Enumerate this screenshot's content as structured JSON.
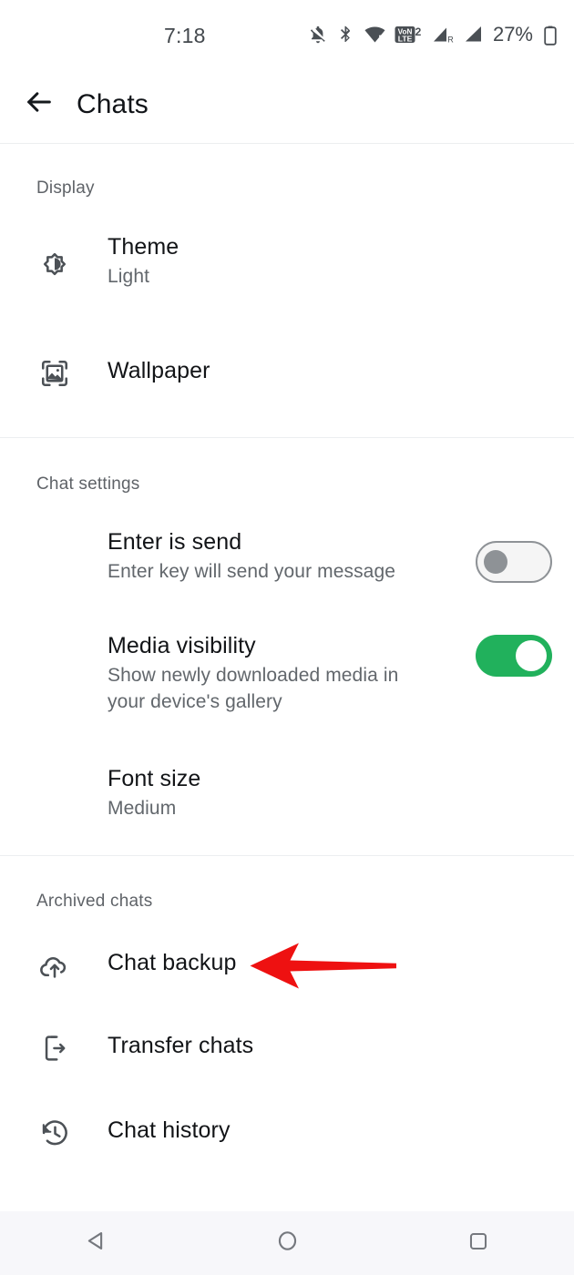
{
  "status_bar": {
    "time": "7:18",
    "battery_percent": "27%",
    "icons": [
      "notifications-off-icon",
      "bluetooth-icon",
      "wifi-icon",
      "volte-2-icon",
      "signal-roaming-icon",
      "signal-icon",
      "battery-icon"
    ]
  },
  "app_bar": {
    "back_label": "back-arrow",
    "title": "Chats"
  },
  "sections": [
    {
      "title": "Display",
      "rows": [
        {
          "icon": "brightness-medium-icon",
          "title": "Theme",
          "subtitle": "Light"
        },
        {
          "icon": "wallpaper-icon",
          "title": "Wallpaper",
          "subtitle": ""
        }
      ]
    },
    {
      "title": "Chat settings",
      "rows": [
        {
          "icon": "",
          "title": "Enter is send",
          "subtitle": "Enter key will send your message",
          "toggle": "off"
        },
        {
          "icon": "",
          "title": "Media visibility",
          "subtitle": "Show newly downloaded media in your device's gallery",
          "toggle": "on"
        },
        {
          "icon": "",
          "title": "Font size",
          "subtitle": "Medium"
        }
      ]
    },
    {
      "title": "Archived chats",
      "rows": [
        {
          "icon": "cloud-upload-icon",
          "title": "Chat backup",
          "subtitle": ""
        },
        {
          "icon": "phone-transfer-icon",
          "title": "Transfer chats",
          "subtitle": ""
        },
        {
          "icon": "history-icon",
          "title": "Chat history",
          "subtitle": ""
        }
      ]
    }
  ],
  "annotation": {
    "type": "arrow",
    "color": "#ee1111",
    "points_to": "Chat backup"
  },
  "nav_bar": {
    "back": "back-triangle-icon",
    "home": "home-circle-icon",
    "recents": "recents-square-icon"
  },
  "colors": {
    "toggle_on": "#21b15c",
    "toggle_off": "#8e9296",
    "annotation_red": "#ee1111",
    "primary_text": "#121417",
    "secondary_text": "#62676c",
    "nav_bar_bg": "#f7f7fa"
  }
}
